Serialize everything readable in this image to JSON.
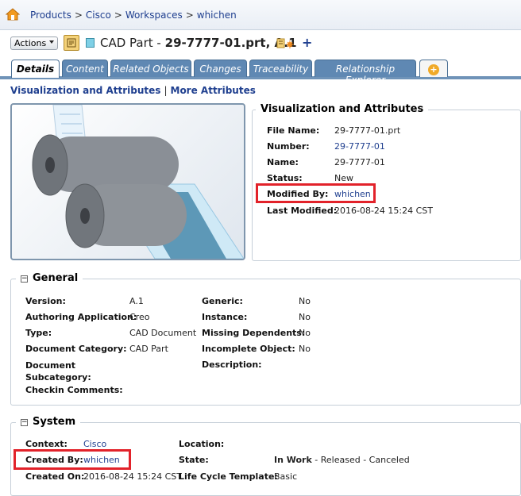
{
  "breadcrumb": [
    "Products",
    "Cisco",
    "Workspaces",
    "whichen"
  ],
  "breadcrumb_separator": ">",
  "header": {
    "actions_label": "Actions",
    "type_label": "CAD Part -",
    "object_name": "29-7777-01.prt, A.1",
    "plus_label": "+"
  },
  "tabs": [
    {
      "label": "Details",
      "active": true
    },
    {
      "label": "Content"
    },
    {
      "label": "Related Objects"
    },
    {
      "label": "Changes"
    },
    {
      "label": "Traceability"
    },
    {
      "label": "Relationship Explorer"
    }
  ],
  "tab_add_icon": "+",
  "subnav": [
    "Visualization and Attributes",
    "More Attributes"
  ],
  "visualization": {
    "title": "Visualization and Attributes",
    "rows": [
      {
        "label": "File Name:",
        "value": "29-7777-01.prt"
      },
      {
        "label": "Number:",
        "value": "29-7777-01",
        "link": true
      },
      {
        "label": "Name:",
        "value": "29-7777-01"
      },
      {
        "label": "Status:",
        "value": "New"
      },
      {
        "label": "Modified By:",
        "value": "whichen",
        "link": true,
        "highlight": true
      },
      {
        "label": "Last Modified:",
        "value": "2016-08-24 15:24 CST"
      }
    ]
  },
  "general": {
    "title": "General",
    "toggle": "⊟",
    "left": [
      {
        "label": "Version:",
        "value": "A.1"
      },
      {
        "label": "Authoring Application:",
        "value": "Creo"
      },
      {
        "label": "Type:",
        "value": "CAD Document"
      },
      {
        "label": "Document Category:",
        "value": "CAD Part"
      },
      {
        "label": "Document Subcategory:",
        "value": ""
      },
      {
        "label": "Checkin Comments:",
        "value": ""
      }
    ],
    "right": [
      {
        "label": "Generic:",
        "value": "No"
      },
      {
        "label": "Instance:",
        "value": "No"
      },
      {
        "label": "Missing Dependents:",
        "value": "No"
      },
      {
        "label": "Incomplete Object:",
        "value": "No"
      },
      {
        "label": "Description:",
        "value": ""
      }
    ]
  },
  "system": {
    "title": "System",
    "toggle": "⊟",
    "left": [
      {
        "label": "Context:",
        "value": "Cisco",
        "link": true
      },
      {
        "label": "Created By:",
        "value": "whichen",
        "link": true,
        "highlight": true
      },
      {
        "label": "Created On:",
        "value": "2016-08-24 15:24 CST"
      }
    ],
    "right": [
      {
        "label": "Location:",
        "value": ""
      },
      {
        "label": "State:",
        "value_bold": "In Work",
        "value_rest": " - Released - Canceled"
      },
      {
        "label": "Life Cycle Template:",
        "value": "Basic"
      }
    ]
  },
  "colors": {
    "tab_bg": "#5f88b3",
    "link": "#1f3f8f",
    "highlight": "#e2222a"
  }
}
